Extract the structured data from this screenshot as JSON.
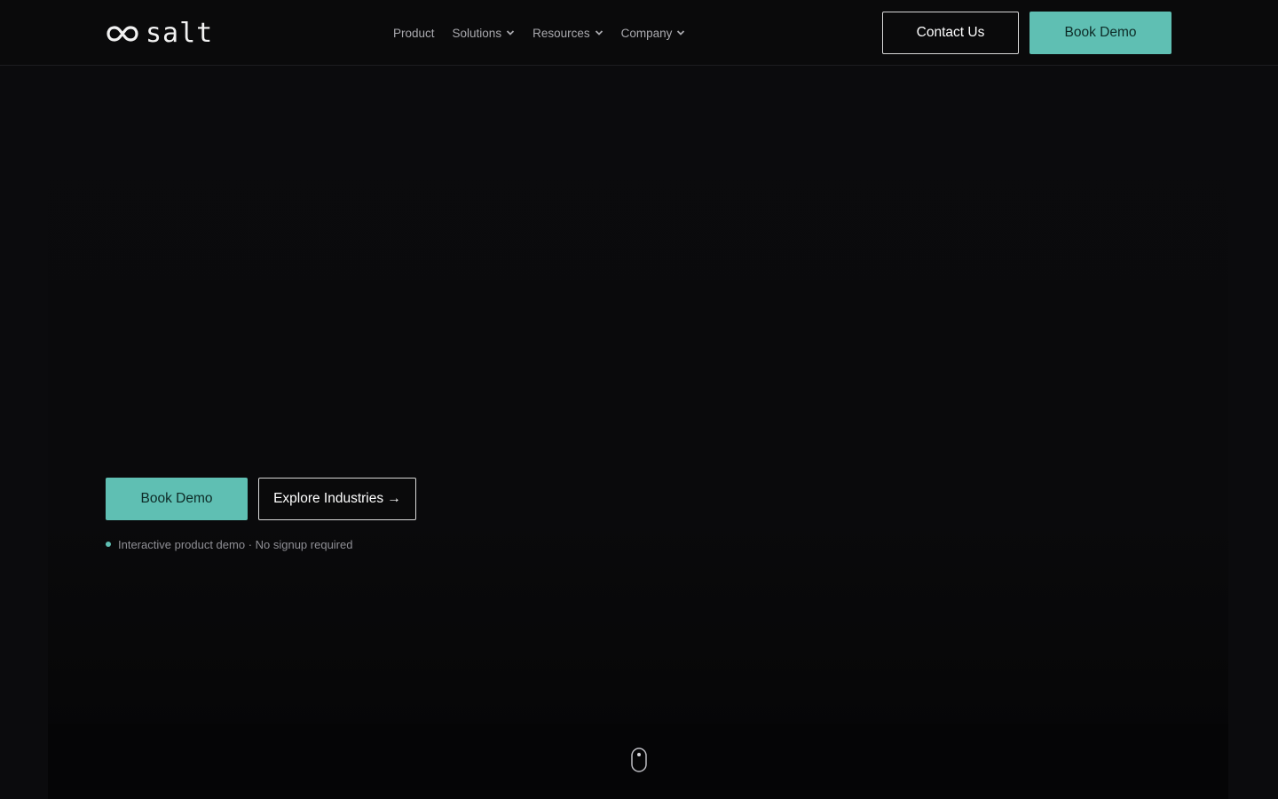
{
  "brand": {
    "name": "salt",
    "logo_icon": "infinity-loop-icon"
  },
  "nav": {
    "items": [
      {
        "label": "Product",
        "has_dropdown": false
      },
      {
        "label": "Solutions",
        "has_dropdown": true
      },
      {
        "label": "Resources",
        "has_dropdown": true
      },
      {
        "label": "Company",
        "has_dropdown": true
      }
    ]
  },
  "header_actions": {
    "contact_label": "Contact Us",
    "book_demo_label": "Book Demo"
  },
  "hero": {
    "book_demo_label": "Book Demo",
    "explore_label": "Explore Industries →",
    "note": "Interactive product demo · No signup required"
  },
  "scroll_indicator": {
    "icon": "mouse-scroll-icon"
  },
  "colors": {
    "background": "#0b0b0d",
    "accent": "#5fbfb3",
    "text_primary": "#ffffff",
    "text_muted": "#a9a9ae"
  }
}
